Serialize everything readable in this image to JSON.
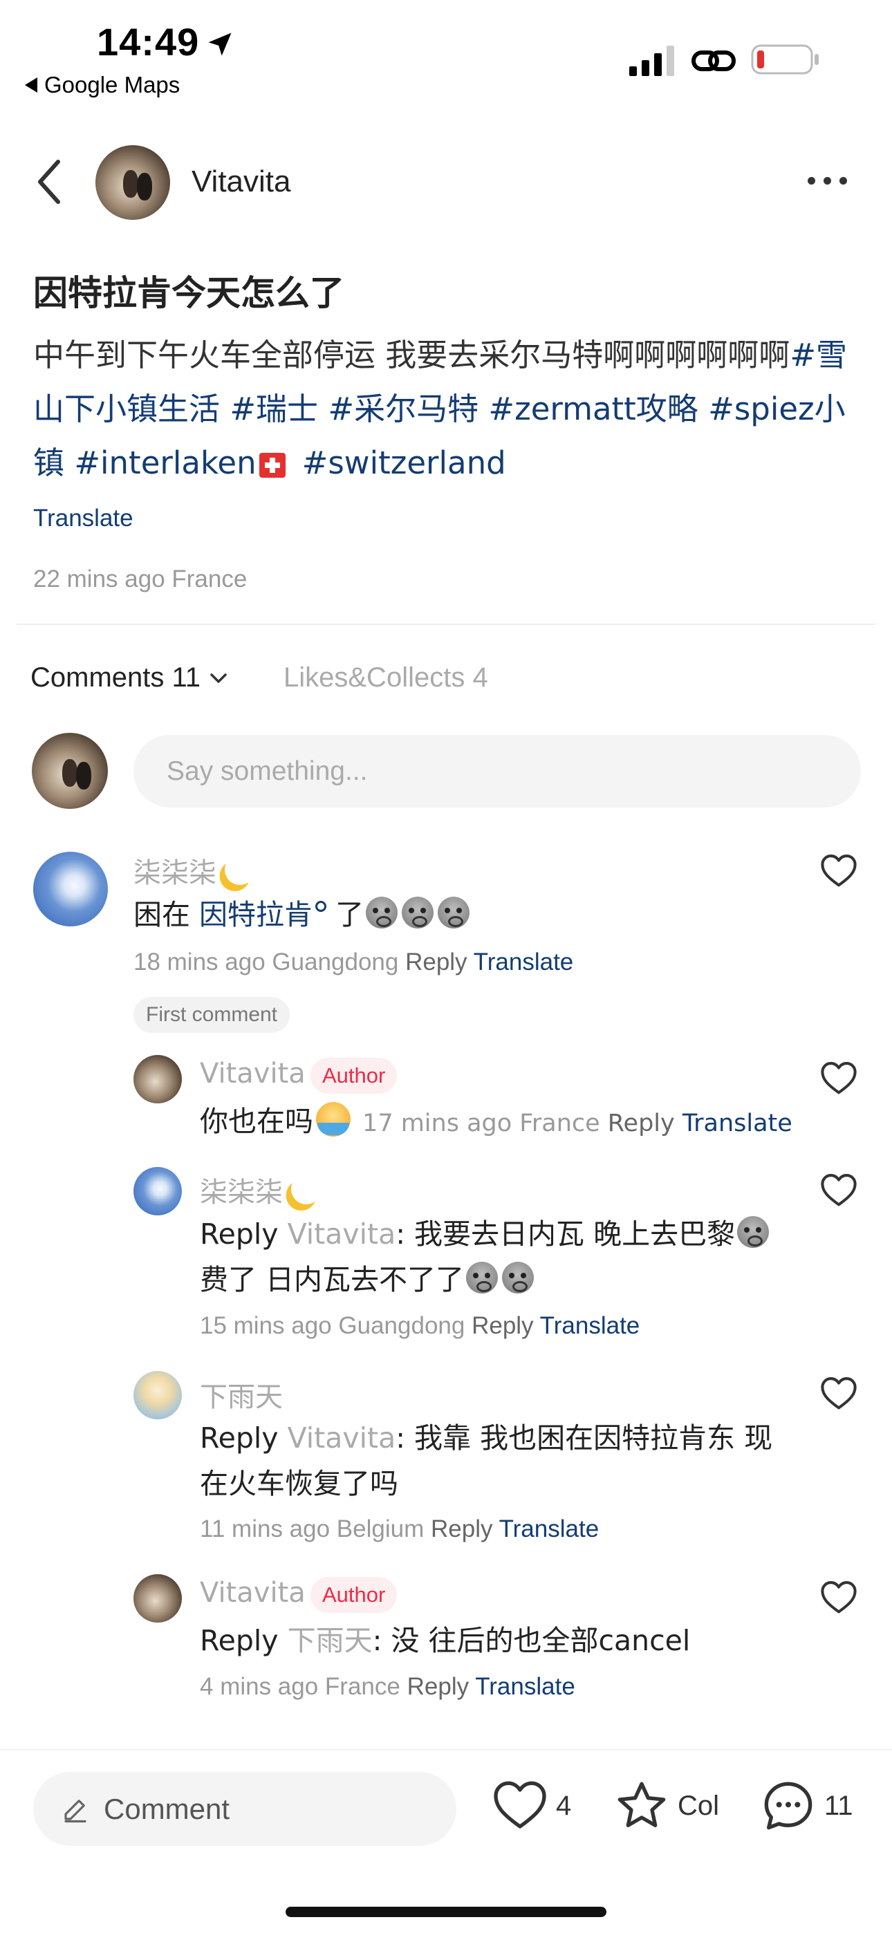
{
  "status_bar": {
    "time": "14:49",
    "back_app": "Google Maps"
  },
  "post": {
    "author": "Vitavita",
    "title": "因特拉肯今天怎么了",
    "body_text": "中午到下午火车全部停运 我要去采尔马特啊啊啊啊啊啊",
    "tags": [
      "#雪山下小镇生活",
      "#瑞士",
      "#采尔马特",
      "#zermatt攻略",
      "#spiez小镇",
      "#interlaken",
      "#switzerland"
    ],
    "translate": "Translate",
    "meta": "22 mins ago France"
  },
  "tabs": {
    "comments": "Comments 11",
    "likes": "Likes&Collects 4"
  },
  "comment_input": {
    "placeholder": "Say something..."
  },
  "comments": [
    {
      "name": "柒柒柒",
      "text_before": "困在",
      "link": "因特拉肯",
      "text_after": "了",
      "time_loc": "18 mins ago Guangdong",
      "reply": "Reply",
      "translate": "Translate",
      "badge": "First comment"
    },
    {
      "name": "Vitavita",
      "badge": "Author",
      "text": "你也在吗",
      "time_loc": "17 mins ago France",
      "reply": "Reply",
      "translate": "Translate"
    },
    {
      "name": "柒柒柒",
      "reply_prefix": "Reply",
      "reply_to": "Vitavita",
      "text_line1": ": 我要去日内瓦 晚上去巴黎",
      "text_line2": "费了 日内瓦去不了了",
      "time_loc": "15 mins ago Guangdong",
      "reply": "Reply",
      "translate": "Translate"
    },
    {
      "name": "下雨天",
      "reply_prefix": "Reply",
      "reply_to": "Vitavita",
      "text_line1": ": 我靠 我也困在因特拉肯东 现",
      "text_line2": "在火车恢复了吗",
      "time_loc": "11 mins ago Belgium",
      "reply": "Reply",
      "translate": "Translate"
    },
    {
      "name": "Vitavita",
      "badge": "Author",
      "reply_prefix": "Reply",
      "reply_to": "下雨天",
      "text_line1": ": 没 往后的也全部cancel",
      "time_loc": "4 mins ago France",
      "reply": "Reply",
      "translate": "Translate"
    }
  ],
  "bottom_bar": {
    "comment_label": "Comment",
    "likes": "4",
    "collect": "Col",
    "comments": "11"
  },
  "colors": {
    "link": "#133c74",
    "author_badge": "#ee2b47",
    "muted": "#999999"
  },
  "icons": [
    "location-arrow-icon",
    "signal-icon",
    "link-icon",
    "battery-icon",
    "back-chevron-icon",
    "more-icon",
    "heart-icon",
    "star-icon",
    "chat-bubble-icon",
    "pencil-icon",
    "chevron-down-icon"
  ]
}
